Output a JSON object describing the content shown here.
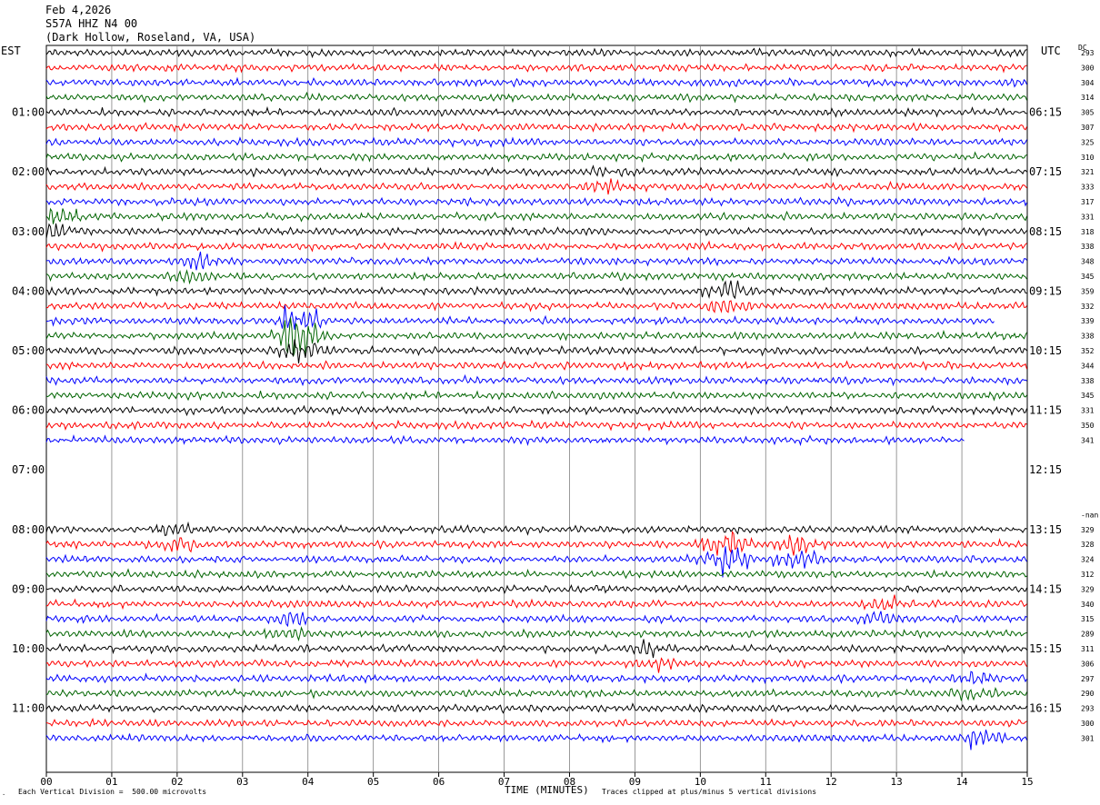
{
  "header": {
    "date": "Feb 4,2026",
    "station": "S57A HHZ N4 00",
    "location": "(Dark Hollow, Roseland, VA, USA)"
  },
  "labels": {
    "left_tz": "EST",
    "right_tz": "UTC",
    "dc": "DC",
    "x_title": "TIME (MINUTES)",
    "scale_note": "Each Vertical Division =  500.00 microvolts",
    "clip_note": "Traces clipped at plus/minus 5 vertical divisions",
    "corner": "."
  },
  "colors": {
    "black": "#000000",
    "red": "#ff0000",
    "blue": "#0000ff",
    "green": "#006400",
    "grid": "#808080"
  },
  "chart_data": {
    "type": "line",
    "title": "S57A HHZ N4 00",
    "xlabel": "TIME (MINUTES)",
    "xlim": [
      0,
      15
    ],
    "x_ticks": [
      "00",
      "01",
      "02",
      "03",
      "04",
      "05",
      "06",
      "07",
      "08",
      "09",
      "10",
      "11",
      "12",
      "13",
      "14",
      "15"
    ],
    "left_hour_labels": [
      "01:00",
      "02:00",
      "03:00",
      "04:00",
      "05:00",
      "06:00",
      "07:00",
      "08:00",
      "09:00",
      "10:00",
      "11:00"
    ],
    "right_hour_labels": [
      "06:15",
      "07:15",
      "08:15",
      "09:15",
      "10:15",
      "11:15",
      "12:15",
      "13:15",
      "14:15",
      "15:15",
      "16:15"
    ],
    "trace_color_cycle": [
      "black",
      "red",
      "blue",
      "green"
    ],
    "dc_values": [
      "293",
      "300",
      "304",
      "314",
      "305",
      "307",
      "325",
      "310",
      "321",
      "333",
      "317",
      "331",
      "318",
      "338",
      "348",
      "345",
      "359",
      "332",
      "339",
      "338",
      "352",
      "344",
      "338",
      "345",
      "331",
      "350",
      "341",
      "",
      "",
      "",
      "",
      "-nan",
      "329",
      "328",
      "324",
      "312",
      "329",
      "340",
      "315",
      "289",
      "311",
      "306",
      "297",
      "290",
      "293",
      "300",
      "301"
    ],
    "traces_present": [
      true,
      true,
      true,
      true,
      true,
      true,
      true,
      true,
      true,
      true,
      true,
      true,
      true,
      true,
      true,
      true,
      true,
      true,
      true,
      true,
      true,
      true,
      true,
      true,
      true,
      true,
      true,
      false,
      false,
      false,
      false,
      false,
      true,
      true,
      true,
      true,
      true,
      true,
      true,
      true,
      true,
      true,
      true,
      true,
      true,
      true,
      true
    ],
    "trace_end_minute": [
      15,
      15,
      15,
      15,
      15,
      15,
      15,
      15,
      15,
      15,
      15,
      15,
      15,
      15,
      15,
      15,
      15,
      15,
      14.5,
      15,
      15,
      15,
      15,
      15,
      15,
      15,
      14.05,
      0,
      0,
      0,
      0,
      0,
      15,
      15,
      15,
      15,
      15,
      15,
      15,
      15,
      15,
      15,
      15,
      15,
      15,
      15,
      15
    ],
    "events": [
      {
        "row": 17,
        "minute": 10.4,
        "amp": 2.2
      },
      {
        "row": 19,
        "minute": 3.9,
        "amp": 3.5
      },
      {
        "row": 20,
        "minute": 3.9,
        "amp": 2.5
      },
      {
        "row": 15,
        "minute": 2.3,
        "amp": 1.6
      },
      {
        "row": 12,
        "minute": 0.2,
        "amp": 1.8
      },
      {
        "row": 9,
        "minute": 8.6,
        "amp": 1.6
      },
      {
        "row": 33,
        "minute": 2.0,
        "amp": 1.8
      },
      {
        "row": 34,
        "minute": 10.4,
        "amp": 4.5
      },
      {
        "row": 34,
        "minute": 11.5,
        "amp": 2.5
      },
      {
        "row": 38,
        "minute": 12.8,
        "amp": 1.6
      },
      {
        "row": 39,
        "minute": 3.7,
        "amp": 1.6
      },
      {
        "row": 41,
        "minute": 9.3,
        "amp": 1.5
      },
      {
        "row": 43,
        "minute": 14.2,
        "amp": 1.5
      },
      {
        "row": 47,
        "minute": 14.2,
        "amp": 1.8
      }
    ]
  }
}
